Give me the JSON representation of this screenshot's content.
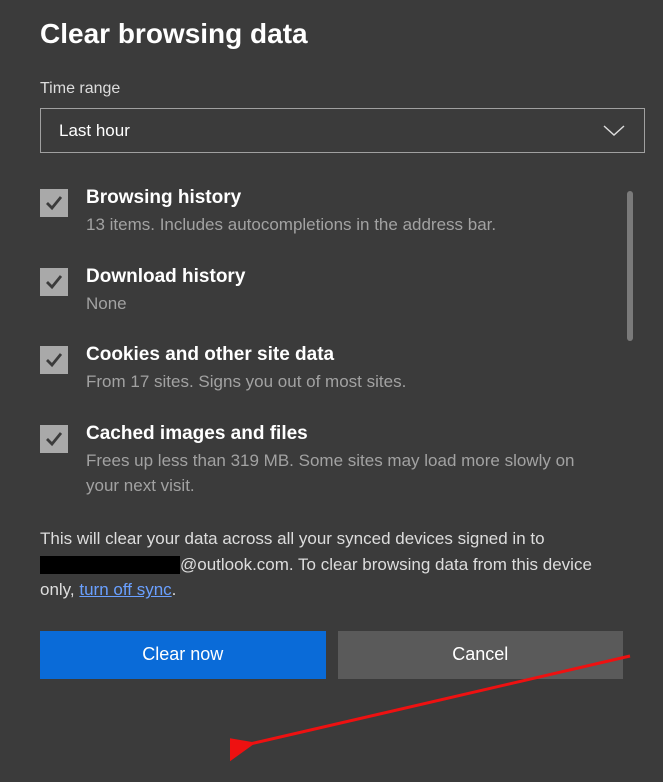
{
  "title": "Clear browsing data",
  "timeRange": {
    "label": "Time range",
    "value": "Last hour"
  },
  "options": [
    {
      "title": "Browsing history",
      "desc": "13 items. Includes autocompletions in the address bar.",
      "checked": true
    },
    {
      "title": "Download history",
      "desc": "None",
      "checked": true
    },
    {
      "title": "Cookies and other site data",
      "desc": "From 17 sites. Signs you out of most sites.",
      "checked": true
    },
    {
      "title": "Cached images and files",
      "desc": "Frees up less than 319 MB. Some sites may load more slowly on your next visit.",
      "checked": true
    }
  ],
  "footnote": {
    "pre": "This will clear your data across all your synced devices signed in to ",
    "email_suffix": "@outlook.com. To clear browsing data from this device only, ",
    "link": "turn off sync",
    "post": "."
  },
  "buttons": {
    "primary": "Clear now",
    "secondary": "Cancel"
  }
}
